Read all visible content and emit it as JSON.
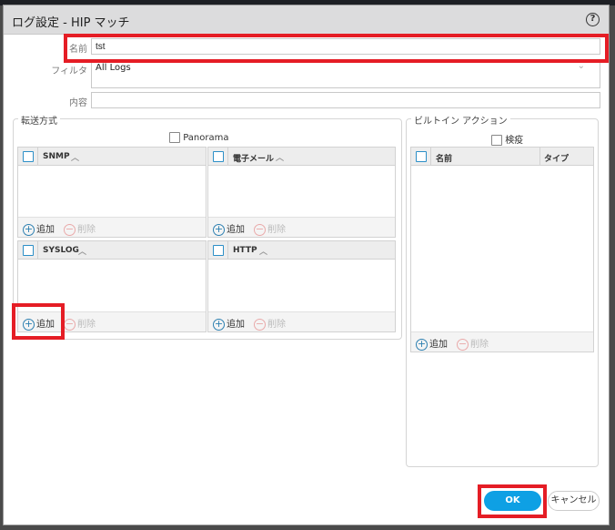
{
  "title": "ログ設定 - HIP マッチ",
  "form": {
    "name_label": "名前",
    "name_value": "tst",
    "filter_label": "フィルタ",
    "filter_value": "All Logs",
    "desc_label": "内容",
    "desc_value": ""
  },
  "forward": {
    "legend": "転送方式",
    "panorama": "Panorama",
    "tables": [
      {
        "header": "SNMP"
      },
      {
        "header": "電子メール"
      },
      {
        "header": "SYSLOG"
      },
      {
        "header": "HTTP"
      }
    ]
  },
  "builtin": {
    "legend": "ビルトイン アクション",
    "quarantine": "検疫",
    "col_name": "名前",
    "col_type": "タイプ"
  },
  "actions": {
    "add": "追加",
    "delete": "削除"
  },
  "buttons": {
    "ok": "OK",
    "cancel": "キャンセル"
  },
  "colors": {
    "accent": "#0ea0e4",
    "highlight": "#e51d25"
  }
}
